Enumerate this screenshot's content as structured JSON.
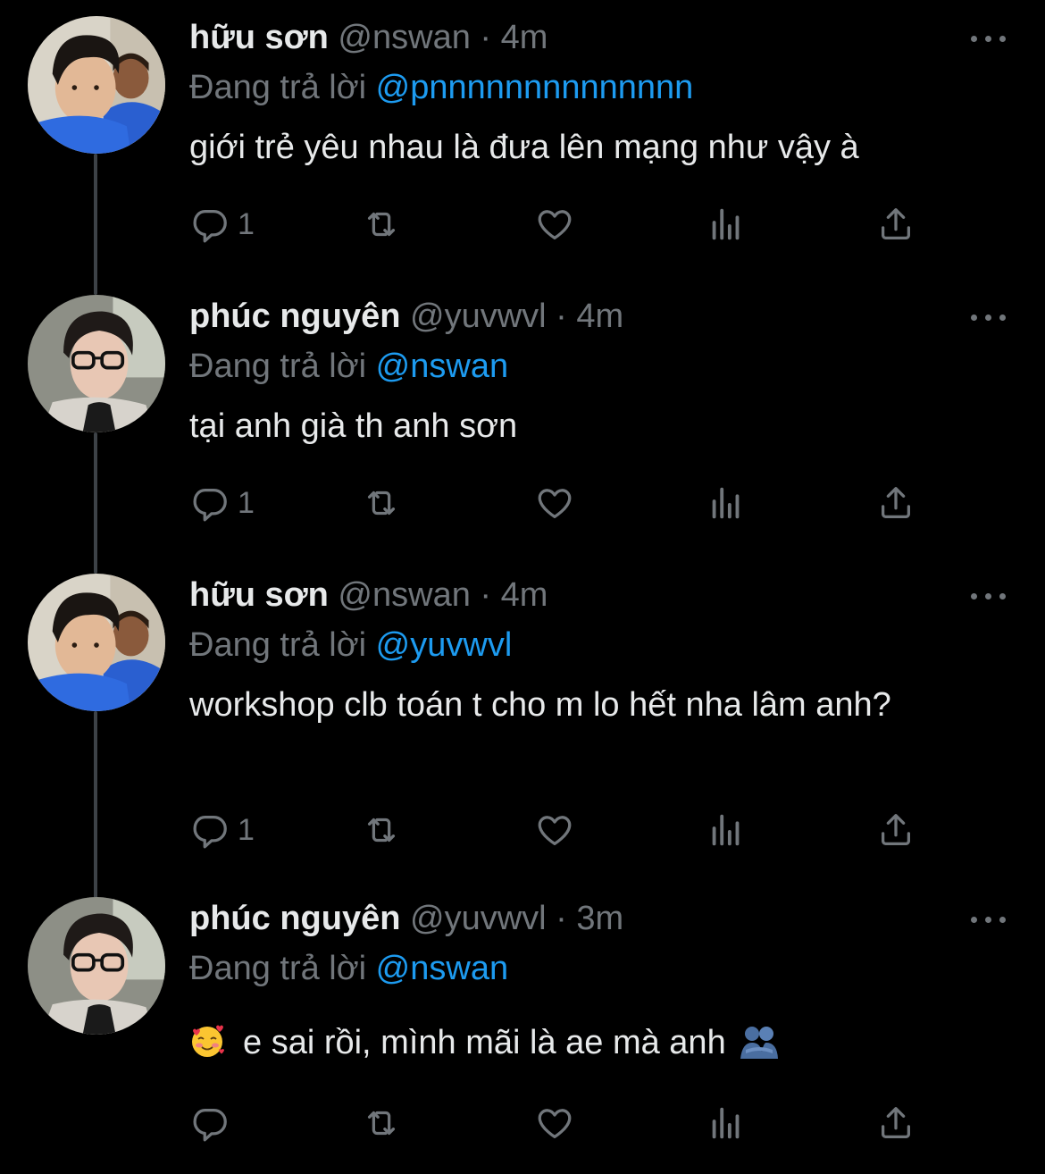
{
  "tweets": [
    {
      "name": "hữu sơn",
      "handle": "@nswan",
      "time": "4m",
      "reply_prefix": "Đang trả lời",
      "reply_to": "@pnnnnnnnnnnnnnn",
      "text": "giới trẻ yêu nhau là đưa lên mạng như vậy à",
      "reply_count": "1"
    },
    {
      "name": "phúc nguyên",
      "handle": "@yuvwvl",
      "time": "4m",
      "reply_prefix": "Đang trả lời",
      "reply_to": "@nswan",
      "text": "tại anh già th anh sơn",
      "reply_count": "1"
    },
    {
      "name": "hữu sơn",
      "handle": "@nswan",
      "time": "4m",
      "reply_prefix": "Đang trả lời",
      "reply_to": "@yuvwvl",
      "text": "workshop clb toán t cho m lo hết nha lâm anh?",
      "reply_count": "1"
    },
    {
      "name": "phúc nguyên",
      "handle": "@yuvwvl",
      "time": "3m",
      "reply_prefix": "Đang trả lời",
      "reply_to": "@nswan",
      "text": "e sai rồi, mình mãi là ae mà anh",
      "reply_count": ""
    }
  ],
  "separator": "·",
  "icons": {
    "reply": "reply-icon",
    "retweet": "retweet-icon",
    "like": "heart-icon",
    "views": "views-icon",
    "share": "share-icon",
    "more": "more-icon",
    "face": "smiling-face-with-hearts-icon",
    "hug": "people-hugging-icon"
  },
  "colors": {
    "background": "#000000",
    "text": "#e7e9ea",
    "muted": "#71767b",
    "mention": "#1d9bf0",
    "thread_line": "#3d4247"
  }
}
